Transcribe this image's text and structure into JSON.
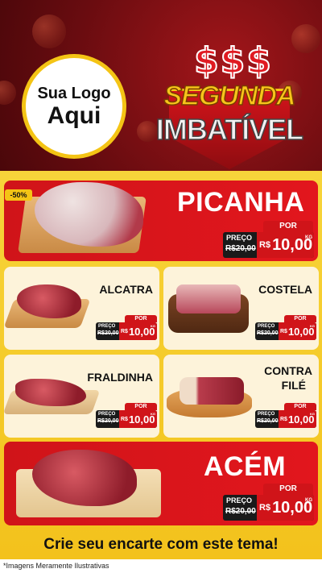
{
  "logo": {
    "line1": "Sua Logo",
    "line2": "Aqui"
  },
  "badge": {
    "dollars": "$$$",
    "title1": "SEGUNDA",
    "title2": "IMBATÍVEL"
  },
  "discount_tag": "-50%",
  "products": [
    {
      "name": "PICANHA",
      "por": "POR",
      "preco_label": "PREÇO",
      "old_price": "R$20,00",
      "currency": "R$",
      "price": "10,00",
      "unit": "KG"
    },
    {
      "name": "ALCATRA",
      "por": "POR",
      "preco_label": "PREÇO",
      "old_price": "R$20,00",
      "currency": "R$",
      "price": "10,00",
      "unit": "KG"
    },
    {
      "name": "COSTELA",
      "por": "POR",
      "preco_label": "PREÇO",
      "old_price": "R$20,00",
      "currency": "R$",
      "price": "10,00",
      "unit": "KG"
    },
    {
      "name": "FRALDINHA",
      "por": "POR",
      "preco_label": "PREÇO",
      "old_price": "R$20,00",
      "currency": "R$",
      "price": "10,00",
      "unit": "KG"
    },
    {
      "name_line1": "CONTRA",
      "name_line2": "FILÉ",
      "por": "POR",
      "preco_label": "PREÇO",
      "old_price": "R$20,00",
      "currency": "R$",
      "price": "10,00",
      "unit": "KG"
    },
    {
      "name": "ACÉM",
      "por": "POR",
      "preco_label": "PREÇO",
      "old_price": "R$20,00",
      "currency": "R$",
      "price": "10,00",
      "unit": "KG"
    }
  ],
  "cta": "Crie seu encarte com este tema!",
  "footer": "*Imagens Meramente Ilustrativas",
  "colors": {
    "red": "#d01419",
    "yellow": "#f4c415",
    "dark_red": "#7a0f12"
  }
}
